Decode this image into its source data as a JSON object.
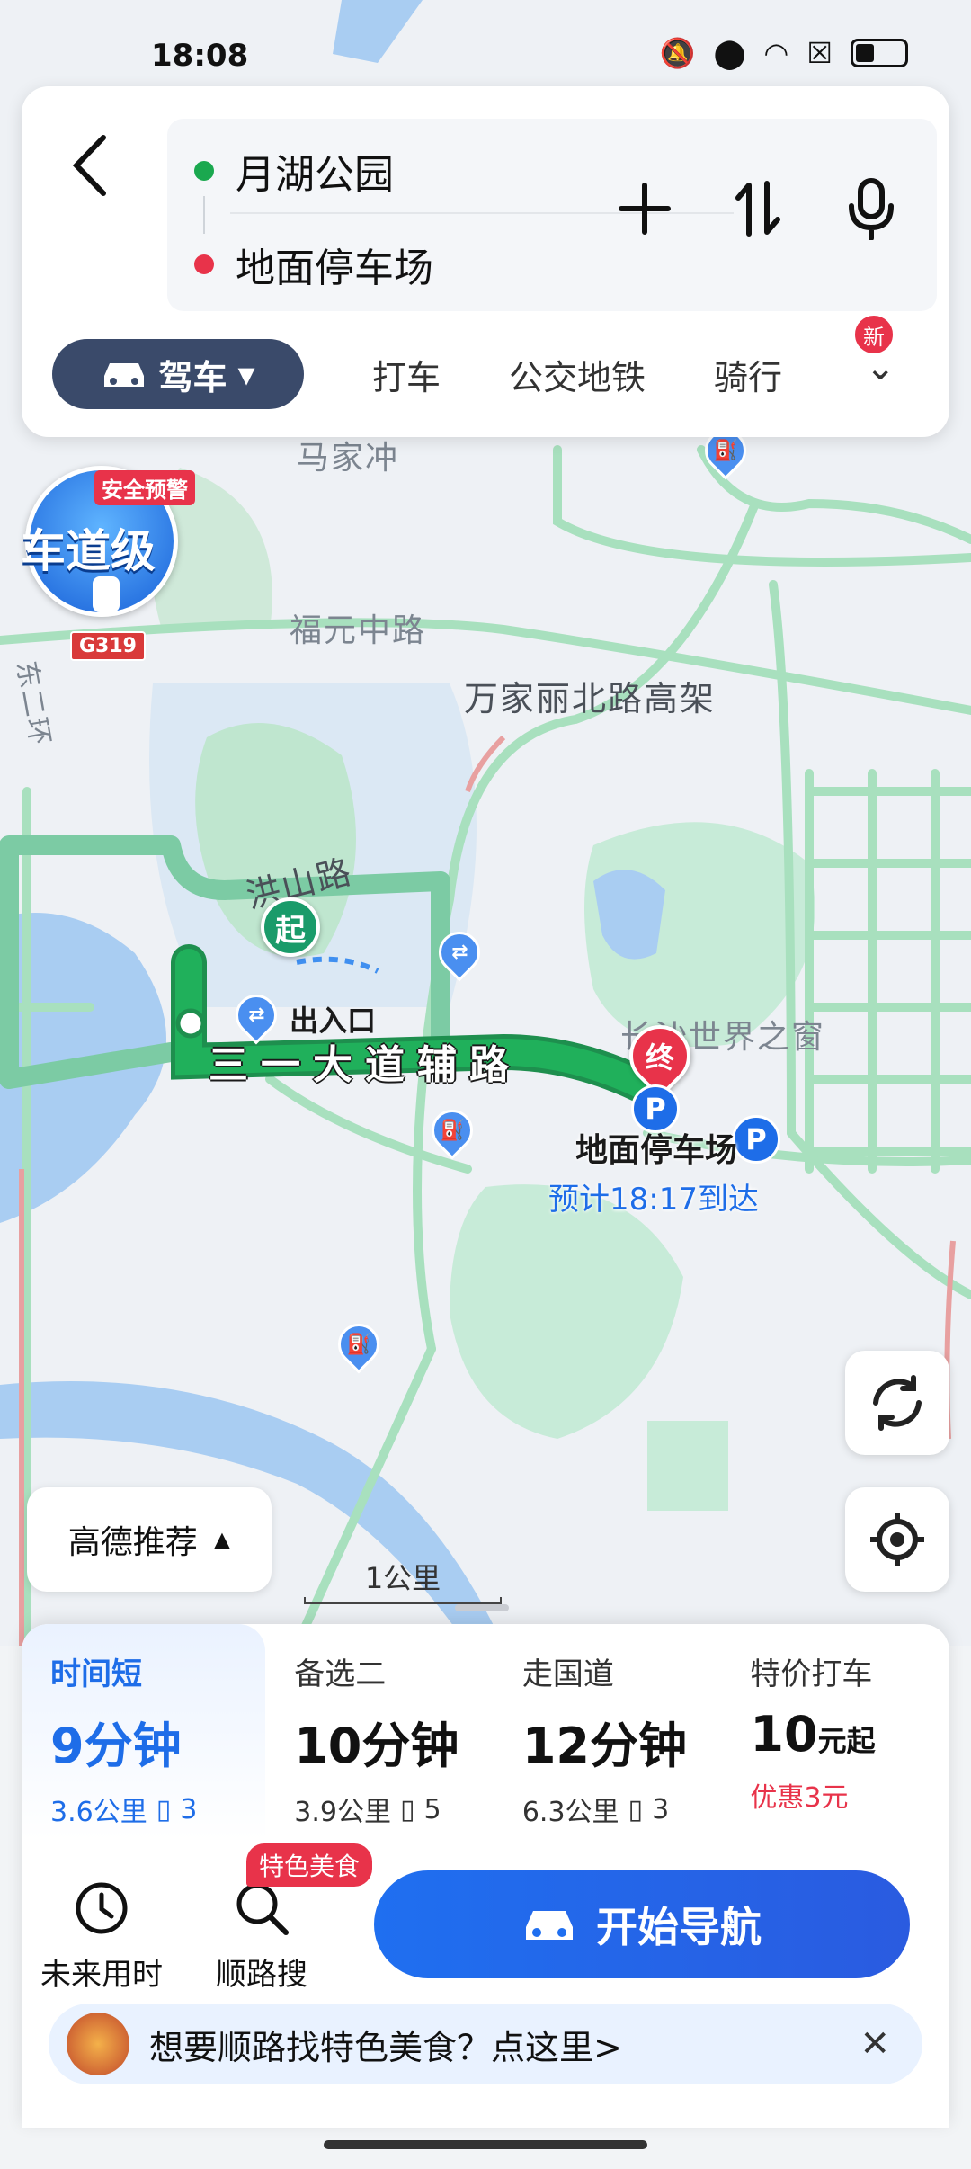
{
  "status_bar": {
    "time": "18:08",
    "icons": [
      "mute-icon",
      "location-icon",
      "wifi-icon",
      "signal-off-icon",
      "battery-icon"
    ]
  },
  "route_input": {
    "back_icon": "chevron-left-icon",
    "origin": "月湖公园",
    "destination": "地面停车场",
    "origin_color": "#1aa84f",
    "destination_color": "#e8334a",
    "actions": [
      "add-stop-icon",
      "swap-icon",
      "microphone-icon"
    ]
  },
  "modes": {
    "active": "驾车",
    "tabs": [
      "打车",
      "公交地铁",
      "骑行"
    ],
    "new_badge": "新"
  },
  "map": {
    "place_labels": [
      "马家冲",
      "福元中路",
      "万家丽北路高架",
      "洪山路",
      "长沙世界之窗"
    ],
    "road_badge": "G319",
    "side_road": "东二环",
    "route_road": "三一大道辅路",
    "start_marker": "起",
    "end_marker": "终",
    "entrance": "出入口",
    "parking_label": "地面停车场",
    "eta": "预计18:17到达",
    "lane_badge_tag": "安全预警",
    "lane_badge_text": "车道级",
    "scale": "1公里",
    "route_color": "#1aa84f",
    "parking_icon": "P"
  },
  "controls": {
    "refresh_icon": "refresh-icon",
    "locate_icon": "locate-icon",
    "recommend_label": "高德推荐"
  },
  "route_options": [
    {
      "tag": "时间短",
      "time": "9分钟",
      "distance": "3.6公里",
      "lights": "3"
    },
    {
      "tag": "备选二",
      "time": "10分钟",
      "distance": "3.9公里",
      "lights": "5"
    },
    {
      "tag": "走国道",
      "time": "12分钟",
      "distance": "6.3公里",
      "lights": "3"
    },
    {
      "tag": "特价打车",
      "price": "10",
      "price_unit": "元起",
      "discount": "优惠3元"
    }
  ],
  "tools": {
    "future_time": "未来用时",
    "along_search": "顺路搜",
    "food_tag": "特色美食"
  },
  "navigate_button": "开始导航",
  "promo": {
    "text": "想要顺路找特色美食？点这里>",
    "close_icon": "close-icon"
  }
}
